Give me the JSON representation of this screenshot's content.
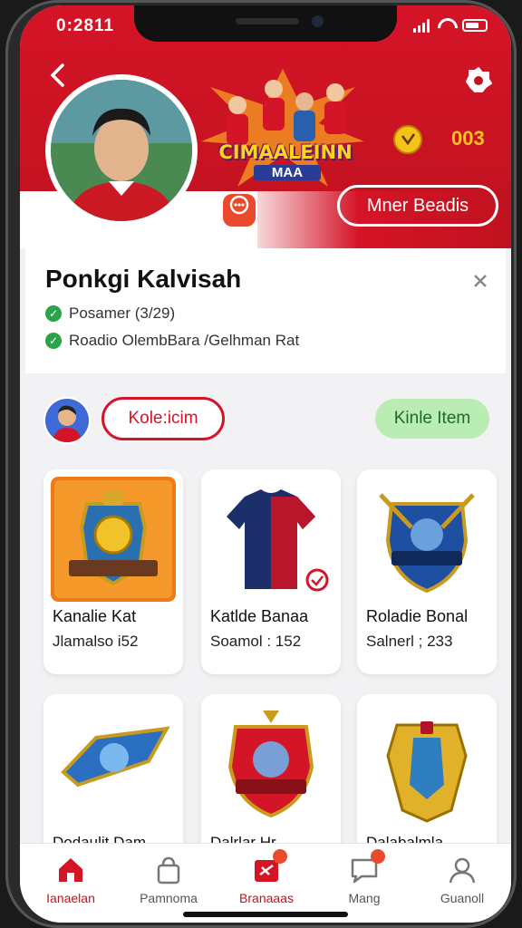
{
  "status": {
    "time": "0:2811"
  },
  "header": {
    "promo_title": "CIMAALEINN",
    "promo_sub": "MAA",
    "coin_label": "003",
    "pill_button": "Mner Beadis"
  },
  "profile": {
    "name": "Ponkgi Kalvisah",
    "line1": "Posamer (3/29)",
    "line2": "Roadio OlembBara /Gelhman Rat"
  },
  "actions": {
    "collect": "Kole:icim",
    "kinle": "Kinle Item"
  },
  "items": [
    {
      "title": "Kanalie Kat",
      "sub": "Jlamalso i52"
    },
    {
      "title": "Katlde Banaa",
      "sub": "Soamol : 152"
    },
    {
      "title": "Roladie Bonal",
      "sub": "Salnerl ; 233"
    }
  ],
  "items_row2": [
    {
      "title": "Dodaulit Dam"
    },
    {
      "title": "Dalrlar Hr"
    },
    {
      "title": "Dalabalmla"
    }
  ],
  "tabs": [
    {
      "label": "Ianaelan",
      "icon": "home-icon"
    },
    {
      "label": "Pamnoma",
      "icon": "bag-icon"
    },
    {
      "label": "Branaaas",
      "icon": "ticket-icon"
    },
    {
      "label": "Mang",
      "icon": "chat-icon"
    },
    {
      "label": "Guanoll",
      "icon": "profile-icon"
    }
  ],
  "colors": {
    "brand": "#d41427",
    "accent_green": "#b9edb3"
  }
}
